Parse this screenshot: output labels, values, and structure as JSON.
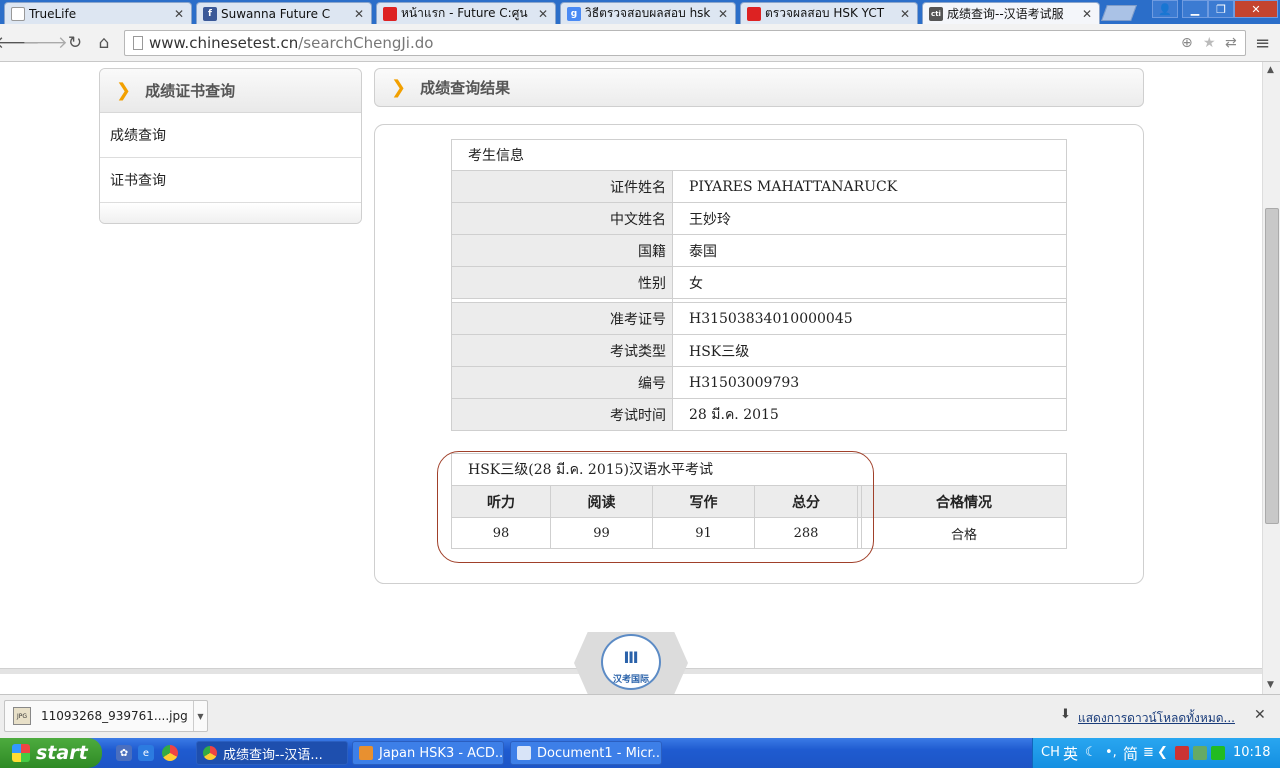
{
  "browser": {
    "tabs": [
      {
        "title": "TrueLife",
        "favicon": "page-icon",
        "favicon_color": "#dde6f2"
      },
      {
        "title": "Suwanna Future C",
        "favicon": "facebook-icon",
        "favicon_color": "#3b5998"
      },
      {
        "title": "หน้าแรก - Future C:ศูน",
        "favicon": "china-flag-icon",
        "favicon_color": "#d22"
      },
      {
        "title": "วิธีตรวจสอบผลสอบ hsk",
        "favicon": "google-icon",
        "favicon_color": "#4a8af4"
      },
      {
        "title": "ตรวจผลสอบ HSK YCT",
        "favicon": "china-flag-icon",
        "favicon_color": "#d22"
      },
      {
        "title": "成绩查询--汉语考试服",
        "favicon": "cti-icon",
        "favicon_color": "#555"
      }
    ],
    "url_host": "www.chinesetest.cn",
    "url_path": "/searchChengJi.do"
  },
  "sidebar": {
    "title": "成绩证书查询",
    "items": [
      {
        "label": "成绩查询"
      },
      {
        "label": "证书查询"
      }
    ]
  },
  "result": {
    "title": "成绩查询结果",
    "info_caption": "考生信息",
    "person": [
      {
        "label": "证件姓名",
        "value": "PIYARES MAHATTANARUCK"
      },
      {
        "label": "中文姓名",
        "value": "王妙玲"
      },
      {
        "label": "国籍",
        "value": "泰国"
      },
      {
        "label": "性别",
        "value": "女"
      }
    ],
    "exam": [
      {
        "label": "准考证号",
        "value": "H31503834010000045"
      },
      {
        "label": "考试类型",
        "value": "HSK三级"
      },
      {
        "label": "编号",
        "value": "H31503009793"
      },
      {
        "label": "考试时间",
        "value": "28 มี.ค. 2015"
      }
    ],
    "score_caption": "HSK三级(28 มี.ค. 2015)汉语水平考试",
    "score_headers": [
      "听力",
      "阅读",
      "写作",
      "总分",
      "合格情况"
    ],
    "scores": [
      "98",
      "99",
      "91",
      "288",
      "合格"
    ]
  },
  "footer": {
    "emblem_text": "汉考国际"
  },
  "downloads": {
    "file_name": "11093268_939761....jpg",
    "show_all": "แสดงการดาวน์โหลดทั้งหมด..."
  },
  "taskbar": {
    "start_label": "start",
    "tasks": [
      {
        "label": "成绩查询--汉语..."
      },
      {
        "label": "Japan HSK3 - ACD..."
      },
      {
        "label": "Document1 - Micr..."
      }
    ],
    "ime_lang": "CH",
    "ime_mode": "英",
    "ime_script": "简",
    "clock": "10:18"
  },
  "colors": {
    "accent_chevron": "#f2a000",
    "highlight_circle": "#a0402a",
    "taskbar": "#1f5bd0"
  }
}
